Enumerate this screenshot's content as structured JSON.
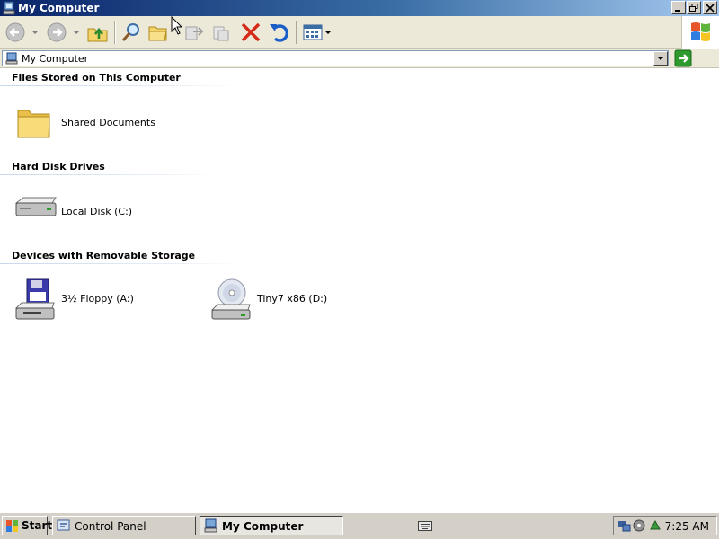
{
  "window": {
    "title": "My Computer"
  },
  "toolbar": {
    "buttons": [
      {
        "name": "back",
        "icon": "back-arrow-icon"
      },
      {
        "name": "forward",
        "icon": "forward-arrow-icon"
      },
      {
        "name": "up",
        "icon": "folder-up-icon"
      },
      {
        "name": "search",
        "icon": "search-icon"
      },
      {
        "name": "folders",
        "icon": "folders-icon"
      },
      {
        "name": "move-to",
        "icon": "move-to-icon"
      },
      {
        "name": "copy-to",
        "icon": "copy-to-icon"
      },
      {
        "name": "delete",
        "icon": "delete-x-icon"
      },
      {
        "name": "undo",
        "icon": "undo-icon"
      },
      {
        "name": "views",
        "icon": "views-icon"
      }
    ]
  },
  "address": {
    "value": "My Computer"
  },
  "groups": [
    {
      "title": "Files Stored on This Computer",
      "items": [
        {
          "label": "Shared Documents",
          "icon": "folder-icon"
        }
      ]
    },
    {
      "title": "Hard Disk Drives",
      "items": [
        {
          "label": "Local Disk (C:)",
          "icon": "hard-disk-icon"
        }
      ]
    },
    {
      "title": "Devices with Removable Storage",
      "items": [
        {
          "label": "3½ Floppy (A:)",
          "icon": "floppy-drive-icon"
        },
        {
          "label": "Tiny7 x86 (D:)",
          "icon": "cd-drive-icon"
        }
      ]
    }
  ],
  "taskbar": {
    "start_label": "Start",
    "tasks": [
      {
        "label": "Control Panel",
        "active": false
      },
      {
        "label": "My Computer",
        "active": true
      }
    ],
    "clock": "7:25 AM"
  },
  "colors": {
    "titlebar_start": "#0a246a",
    "titlebar_end": "#a6caf0",
    "group_line": "#c8d8ec",
    "taskbar": "#d4d0c8"
  }
}
